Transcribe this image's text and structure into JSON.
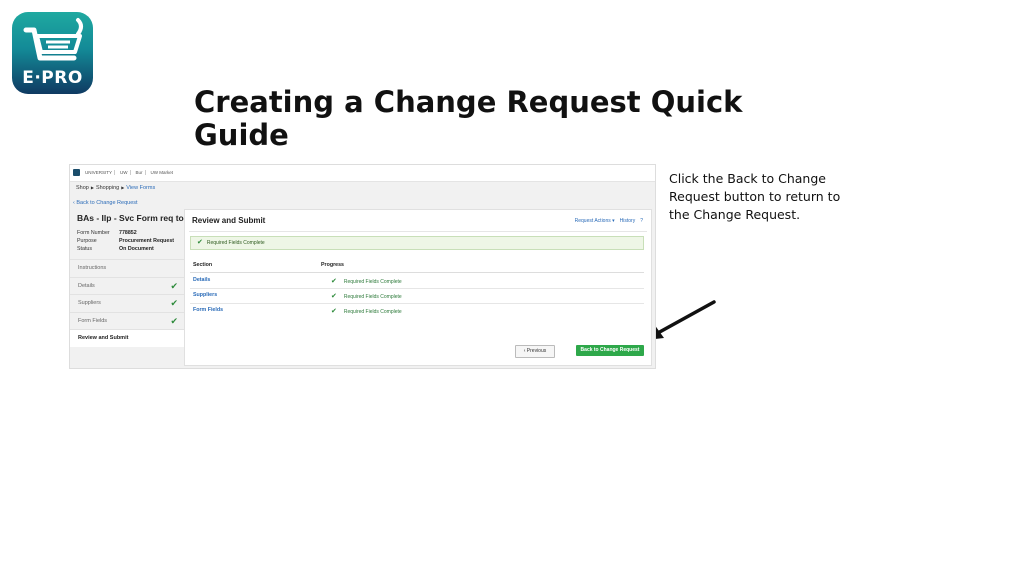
{
  "logo": {
    "text": "E·PRO"
  },
  "slide": {
    "title": "Creating a Change Request Quick Guide",
    "caption": "Click the Back to Change Request button to return to the Change Request."
  },
  "screenshot": {
    "brand_labels": [
      "UNIVERSITY",
      "UW",
      "Bur",
      "UW Market"
    ],
    "breadcrumb": [
      "Shop",
      "Shopping",
      "View Forms"
    ],
    "back_link": "Back to Change Request",
    "form_title": "BAs - Ilp - Svc Form req to ...",
    "meta": [
      {
        "label": "Form Number",
        "value": "778852"
      },
      {
        "label": "Purpose",
        "value": "Procurement Request"
      },
      {
        "label": "Status",
        "value": "On Document"
      }
    ],
    "steps": [
      {
        "label": "Instructions",
        "complete": false
      },
      {
        "label": "Details",
        "complete": true
      },
      {
        "label": "Suppliers",
        "complete": true
      },
      {
        "label": "Form Fields",
        "complete": true
      },
      {
        "label": "Review and Submit",
        "complete": false
      }
    ],
    "main": {
      "title": "Review and Submit",
      "action_request": "Request Actions ▾",
      "action_history": "History",
      "action_help": "?",
      "alert": "Required Fields Complete",
      "col_section": "Section",
      "col_progress": "Progress",
      "rows": [
        {
          "section": "Details",
          "progress": "Required Fields Complete"
        },
        {
          "section": "Suppliers",
          "progress": "Required Fields Complete"
        },
        {
          "section": "Form Fields",
          "progress": "Required Fields Complete"
        }
      ],
      "prev_button": "‹ Previous",
      "back_button": "Back to Change Request"
    }
  },
  "colors": {
    "accent_green": "#2ea84a",
    "link_blue": "#2a6bb8",
    "arrow": "#111111"
  }
}
